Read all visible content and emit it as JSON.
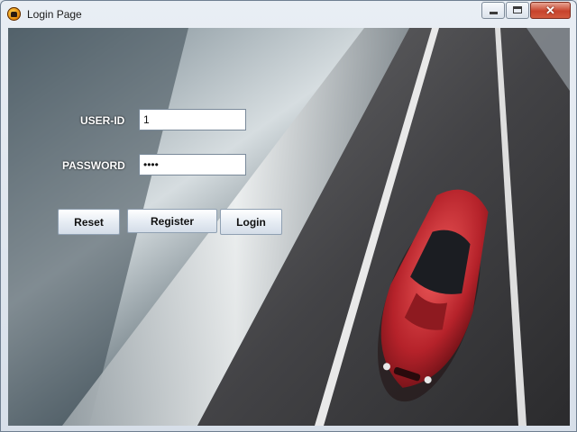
{
  "window": {
    "title": "Login Page",
    "close_glyph": "✕"
  },
  "icons": {
    "app": "app-icon",
    "minimize": "minimize-icon",
    "maximize": "maximize-icon",
    "close": "close-icon"
  },
  "form": {
    "userid_label": "USER-ID",
    "userid_value": "1",
    "password_label": "PASSWORD",
    "password_value": "1234"
  },
  "buttons": {
    "reset": "Reset",
    "register": "Register",
    "login": "Login"
  },
  "colors": {
    "car_red": "#c0292f",
    "road": "#3d3d40",
    "sky": "#4b5a62",
    "lane": "#e9e9e9"
  }
}
